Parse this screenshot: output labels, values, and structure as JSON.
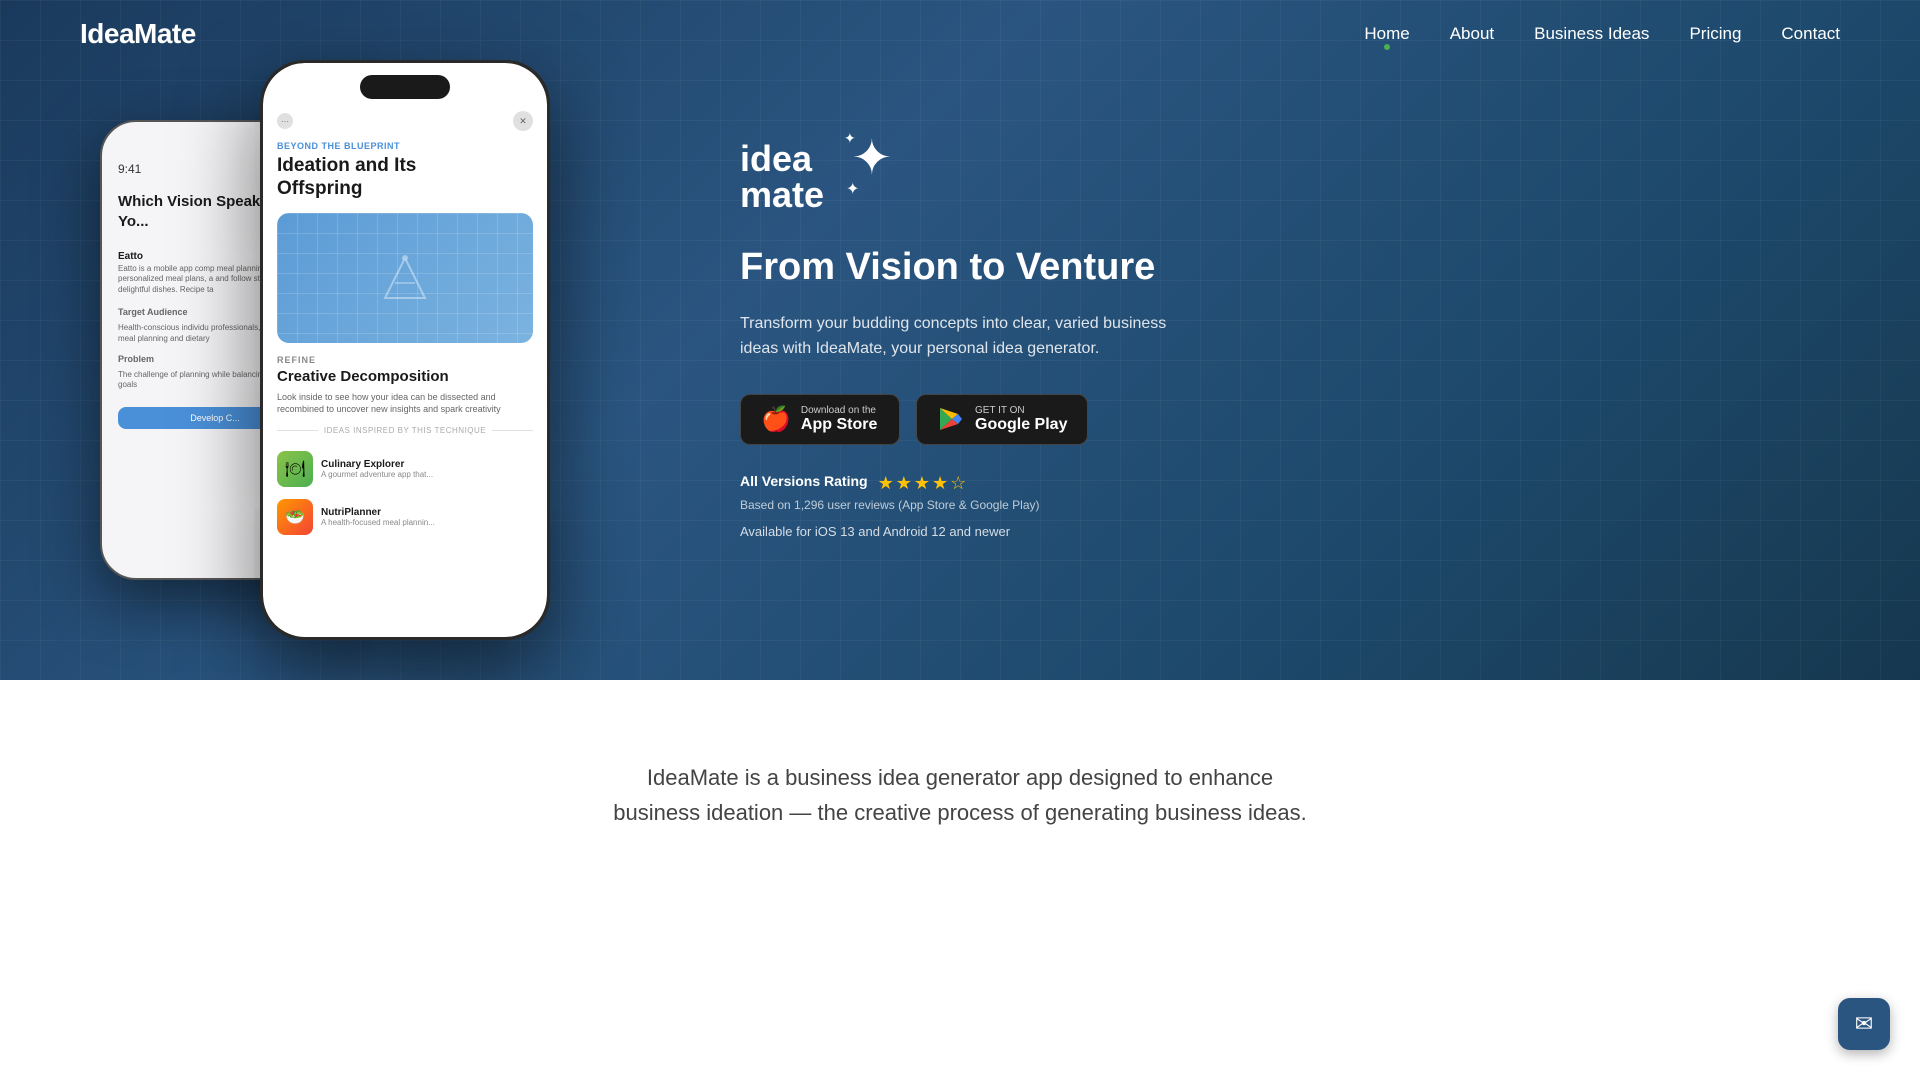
{
  "nav": {
    "logo": "IdeaMate",
    "links": [
      {
        "id": "home",
        "label": "Home",
        "active": true
      },
      {
        "id": "about",
        "label": "About",
        "active": false
      },
      {
        "id": "business-ideas",
        "label": "Business Ideas",
        "active": false
      },
      {
        "id": "pricing",
        "label": "Pricing",
        "active": false
      },
      {
        "id": "contact",
        "label": "Contact",
        "active": false
      }
    ]
  },
  "hero": {
    "brand_line1": "idea",
    "brand_line2": "mate",
    "tagline": "From Vision to Venture",
    "description": "Transform your budding concepts into clear, varied business ideas with IdeaMate, your personal idea generator.",
    "app_store_sub": "Download on the",
    "app_store_main": "App Store",
    "google_play_sub": "GET IT ON",
    "google_play_main": "Google Play",
    "rating_label": "All Versions Rating",
    "rating_sub": "Based on 1,296 user reviews (App Store & Google Play)",
    "availability": "Available for iOS 13 and Android 12 and newer"
  },
  "phone_front": {
    "tag": "BEYOND THE BLUEPRINT",
    "title_line1": "Ideation and Its",
    "title_line2": "Offspring",
    "refine": "REFINE",
    "section_title": "Creative Decomposition",
    "section_desc": "Look inside to see how your idea can be dissected and recombined to uncover new insights and spark creativity",
    "divider_text": "IDEAS INSPIRED BY THIS TECHNIQUE",
    "idea1_name": "Culinary Explorer",
    "idea1_desc": "A gourmet adventure app that...",
    "idea2_name": "NutriPlanner",
    "idea2_desc": "A health-focused meal plannin..."
  },
  "phone_back": {
    "time": "9:41",
    "title": "Which Vision Speaks to Yo...",
    "item1_name": "Eatto",
    "item1_desc": "Eatto is a mobile app comp meal planning that let's us personalized meal plans, a and follow step-by-step in delightful dishes. Recipe ta",
    "section_label": "Target Audience",
    "item2_desc": "Health-conscious individu professionals, and families meal planning and dietary",
    "section2_label": "Problem",
    "item3_desc": "The challenge of planning while balancing dietary pr goals",
    "btn_label": "Develop C..."
  },
  "bottom": {
    "text": "IdeaMate is a business idea generator app designed to enhance business ideation — the creative process of generating business ideas."
  }
}
